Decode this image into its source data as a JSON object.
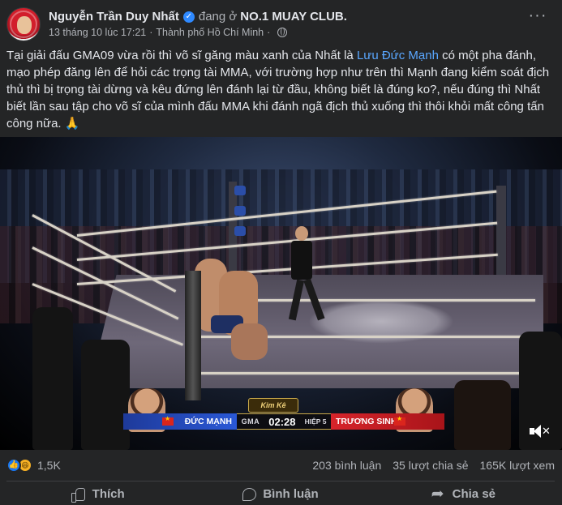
{
  "header": {
    "author": "Nguyễn Trần Duy Nhất",
    "status": "đang ở",
    "location_name": "NO.1 MUAY CLUB.",
    "timestamp": "13 tháng 10 lúc 17:21",
    "separator": "·",
    "place": "Thành phố Hồ Chí Minh",
    "separator2": "·",
    "verified_glyph": "✓",
    "more_glyph": "···",
    "privacy_icon": "globe-icon"
  },
  "post": {
    "text_before": "Tại giải đấu GMA09 vừa rồi thì võ sĩ găng màu xanh của Nhất là ",
    "mention": "Lưu Đức Mạnh",
    "text_after": " có một pha đánh, mạo phép đăng lên để hỏi các trọng tài MMA, với trường hợp như trên thì Mạnh đang kiểm soát địch thủ thì bị trọng tài dừng và kêu đứng lên đánh lại từ đầu, không biết là đúng ko?, nếu đúng thì Nhất biết lần sau tập cho võ sĩ của mình đấu MMA khi đánh ngã địch thủ xuống thì thôi khỏi mất công tấn công nữa. 🙏"
  },
  "video": {
    "scoreboard": {
      "left_name": "ĐỨC MẠNH",
      "brand": "GMA",
      "clock": "02:28",
      "round": "HIỆP 5",
      "right_name": "TRƯƠNG SINH"
    },
    "sponsor": "Kim Kê",
    "watermark": "",
    "mute_icon": "volume-muted-icon"
  },
  "stats": {
    "reactions_count": "1,5K",
    "comments": "203 bình luận",
    "shares": "35 lượt chia sẻ",
    "views": "165K lượt xem",
    "like_glyph": "👍",
    "haha_glyph": "😆"
  },
  "actions": {
    "like": "Thích",
    "comment": "Bình luận",
    "share": "Chia sẻ"
  },
  "colors": {
    "background": "#242526",
    "text": "#e4e6eb",
    "secondary": "#b0b3b8",
    "mention": "#5aa7ff",
    "like_blue": "#1877f2"
  }
}
